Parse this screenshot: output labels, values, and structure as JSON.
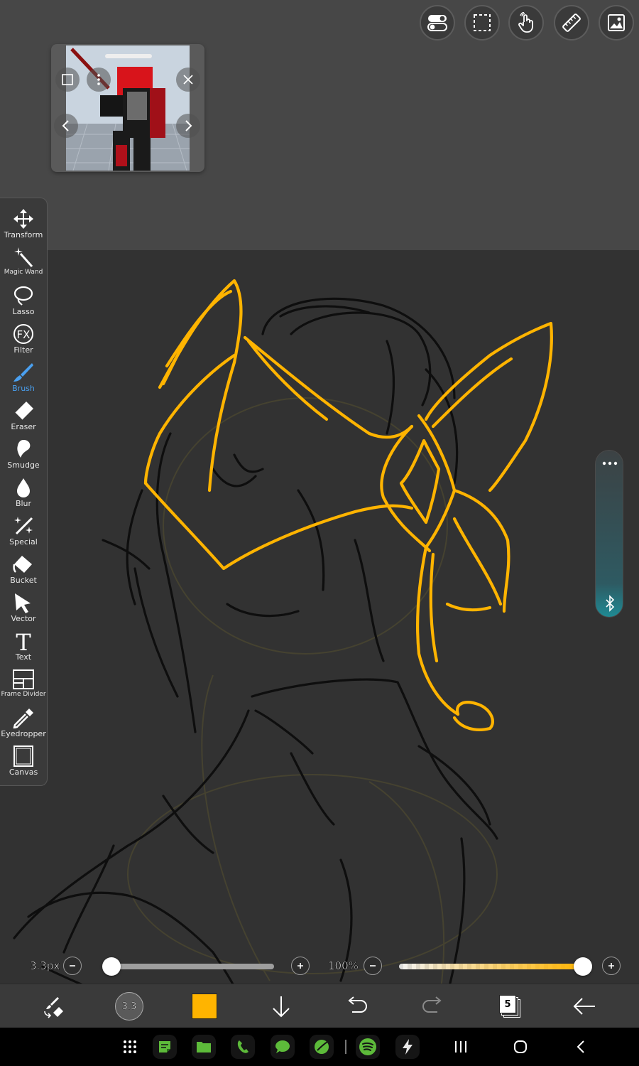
{
  "top_toolbar": {
    "tools": [
      {
        "icon": "toggle-switches-icon"
      },
      {
        "icon": "selection-rectangle-icon"
      },
      {
        "icon": "hand-touch-icon"
      },
      {
        "icon": "ruler-icon"
      },
      {
        "icon": "image-reference-icon"
      }
    ]
  },
  "reference_window": {
    "buttons": [
      "square-icon",
      "more-vertical-icon",
      "close-icon",
      "chevron-left-icon",
      "chevron-right-icon"
    ]
  },
  "tool_panel": {
    "items": [
      {
        "label": "Transform",
        "icon": "move-arrows-icon",
        "active": false
      },
      {
        "label": "Magic Wand",
        "icon": "magic-wand-icon",
        "active": false
      },
      {
        "label": "Lasso",
        "icon": "lasso-icon",
        "active": false
      },
      {
        "label": "Filter",
        "icon": "fx-icon",
        "active": false
      },
      {
        "label": "Brush",
        "icon": "brush-icon",
        "active": true
      },
      {
        "label": "Eraser",
        "icon": "eraser-icon",
        "active": false
      },
      {
        "label": "Smudge",
        "icon": "smudge-icon",
        "active": false
      },
      {
        "label": "Blur",
        "icon": "blur-drop-icon",
        "active": false
      },
      {
        "label": "Special",
        "icon": "special-brush-icon",
        "active": false
      },
      {
        "label": "Bucket",
        "icon": "bucket-icon",
        "active": false
      },
      {
        "label": "Vector",
        "icon": "vector-arrow-icon",
        "active": false
      },
      {
        "label": "Text",
        "icon": "text-icon",
        "active": false
      },
      {
        "label": "Frame Divider",
        "icon": "frame-divider-icon",
        "active": false
      },
      {
        "label": "Eyedropper",
        "icon": "eyedropper-icon",
        "active": false
      },
      {
        "label": "Canvas",
        "icon": "canvas-icon",
        "active": false
      }
    ]
  },
  "side_widget": {
    "icons": [
      "more-horizontal-icon",
      "bluetooth-icon"
    ]
  },
  "brush_size": {
    "value_label": "3.3px",
    "fraction": 0.0
  },
  "opacity": {
    "value_label": "100%",
    "fraction": 1.0
  },
  "bottom_toolbar": {
    "brush_preview_label": "3.3",
    "color": "#ffb400",
    "layers_count": "5"
  },
  "nav_bar": {
    "apps": [
      "apps-grid-icon",
      "notes-app-icon",
      "files-app-icon",
      "phone-app-icon",
      "messages-app-icon",
      "ibis-paint-icon",
      "spotify-icon",
      "bolt-app-icon"
    ],
    "buttons": [
      "recents-icon",
      "home-icon",
      "back-icon"
    ]
  },
  "colors": {
    "accent_blue": "#4aa0f0",
    "line_yellow": "#ffb400",
    "canvas_bg": "#323232",
    "app_bg": "#474747"
  }
}
